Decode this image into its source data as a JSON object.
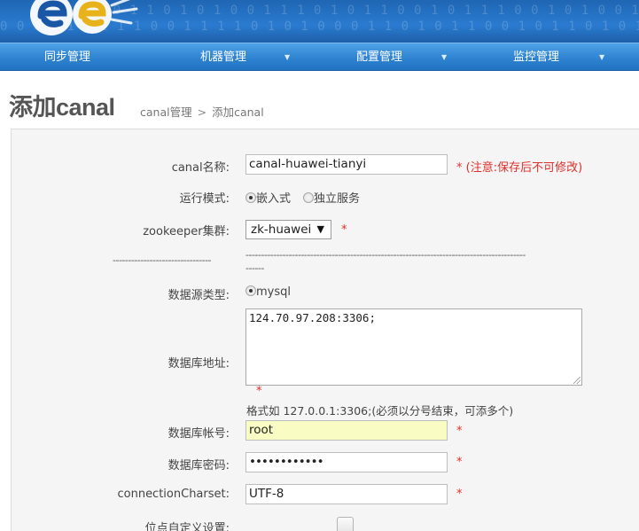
{
  "nav": {
    "items": [
      {
        "label": "同步管理",
        "has_dropdown": false
      },
      {
        "label": "机器管理",
        "has_dropdown": true
      },
      {
        "label": "配置管理",
        "has_dropdown": true
      },
      {
        "label": "监控管理",
        "has_dropdown": true
      }
    ]
  },
  "page": {
    "title": "添加canal",
    "breadcrumb": {
      "parent": "canal管理",
      "separator": ">",
      "current": "添加canal"
    }
  },
  "form": {
    "canal_name": {
      "label": "canal名称:",
      "value": "canal-huawei-tianyi",
      "required_mark": "*",
      "hint": "(注意:保存后不可修改)"
    },
    "run_mode": {
      "label": "运行模式:",
      "options": [
        "嵌入式",
        "独立服务"
      ],
      "selected": "嵌入式"
    },
    "zookeeper": {
      "label": "zookeeper集群:",
      "value": "zk-huawei",
      "required_mark": "*"
    },
    "separator_left": "--------------------------------",
    "separator_right": "-------------------------------------------------------------------------------------------",
    "separator_right2": "------",
    "source_type": {
      "label": "数据源类型:",
      "options": [
        "mysql"
      ],
      "selected": "mysql"
    },
    "db_address": {
      "label": "数据库地址:",
      "value": "124.70.97.208:3306;",
      "required_mark": "*",
      "hint": "格式如 127.0.0.1:3306;(必须以分号结束，可添多个)"
    },
    "db_account": {
      "label": "数据库帐号:",
      "value": "root",
      "required_mark": "*"
    },
    "db_password": {
      "label": "数据库密码:",
      "value": "••••••••••••",
      "required_mark": "*"
    },
    "charset": {
      "label": "connectionCharset:",
      "value": "UTF-8",
      "required_mark": "*"
    },
    "position": {
      "label": "位点自定义设置:",
      "checked": false
    }
  },
  "colors": {
    "nav_bg": "#2f83d0",
    "banner_bg": "#1f66b3",
    "required": "#e0302b",
    "highlight_input": "#fafdc3"
  }
}
